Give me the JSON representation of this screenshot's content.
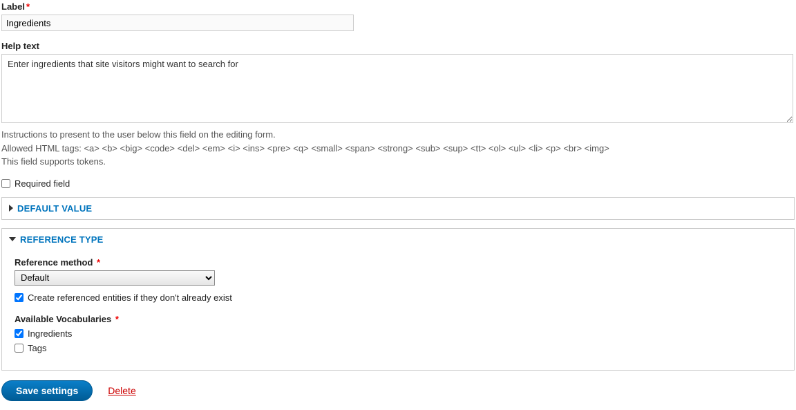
{
  "label_section": {
    "label": "Label",
    "value": "Ingredients"
  },
  "help_text_section": {
    "label": "Help text",
    "value": "Enter ingredients that site visitors might want to search for",
    "desc_line1": "Instructions to present to the user below this field on the editing form.",
    "desc_line2": "Allowed HTML tags: <a> <b> <big> <code> <del> <em> <i> <ins> <pre> <q> <small> <span> <strong> <sub> <sup> <tt> <ol> <ul> <li> <p> <br> <img>",
    "desc_line3": "This field supports tokens."
  },
  "required_field": {
    "label": "Required field"
  },
  "default_value": {
    "title": "Default value"
  },
  "reference_type": {
    "title": "Reference type",
    "method_label": "Reference method",
    "method_value": "Default",
    "create_label": "Create referenced entities if they don't already exist",
    "vocab_label": "Available Vocabularies",
    "vocab_options": {
      "ingredients": "Ingredients",
      "tags": "Tags"
    }
  },
  "actions": {
    "save": "Save settings",
    "delete": "Delete"
  }
}
